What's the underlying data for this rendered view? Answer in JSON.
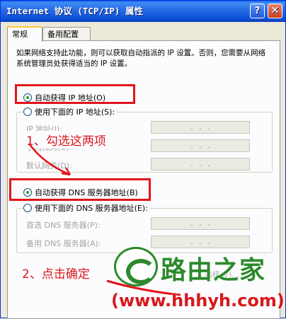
{
  "window": {
    "title": "Internet 协议 (TCP/IP) 属性",
    "help_label": "?",
    "close_label": "✕"
  },
  "tabs": [
    {
      "label": "常规"
    },
    {
      "label": "备用配置"
    }
  ],
  "description": "如果网络支持此功能，则可以获取自动指派的 IP 设置。否则，您需要从网络系统管理员处获得适当的 IP 设置。",
  "ip_section": {
    "auto_label": "自动获得 IP 地址(O)",
    "manual_label": "使用下面的 IP 地址(S):",
    "fields": [
      {
        "label": "IP 地址(I):"
      },
      {
        "label": "子网掩码(U):"
      },
      {
        "label": "默认网关(D):"
      }
    ]
  },
  "dns_section": {
    "auto_label": "自动获得 DNS 服务器地址(B)",
    "manual_label": "使用下面的 DNS 服务器地址(E):",
    "fields": [
      {
        "label": "首选 DNS 服务器(P):"
      },
      {
        "label": "备用 DNS 服务器(A):"
      }
    ]
  },
  "ip_dots": ". . .",
  "advanced_label": "高级(V)...",
  "annotations": {
    "step1": "1、勾选这两项",
    "step2": "2、点击确定"
  },
  "watermark": {
    "name": "路由之家",
    "url": "(www.hhhyh.com)"
  },
  "colors": {
    "annotation_red": "#E3141B",
    "title_blue": "#0A5FEA",
    "watermark_green": "#2C8A2C"
  }
}
